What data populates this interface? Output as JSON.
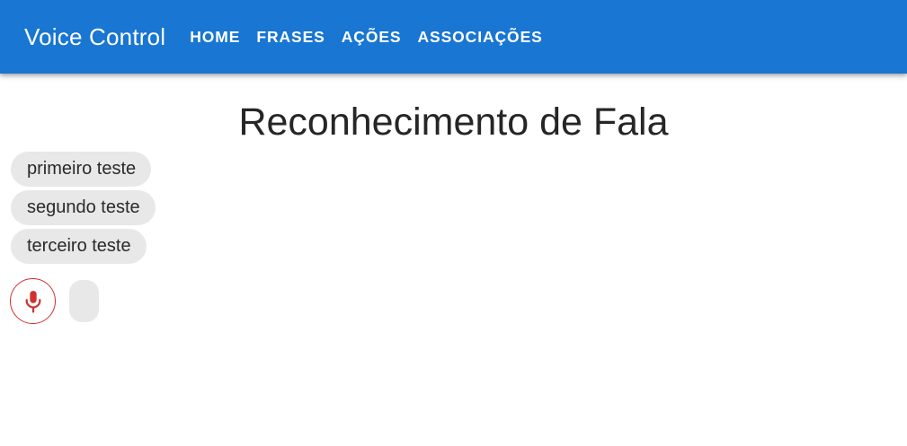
{
  "appbar": {
    "brand": "Voice Control",
    "color": "#1976d2",
    "nav": [
      {
        "label": "HOME"
      },
      {
        "label": "FRASES"
      },
      {
        "label": "AÇÕES"
      },
      {
        "label": "ASSOCIAÇÕES"
      }
    ]
  },
  "main": {
    "title": "Reconhecimento de Fala",
    "phrases": [
      {
        "text": "primeiro teste"
      },
      {
        "text": "segundo teste"
      },
      {
        "text": "terceiro teste"
      }
    ],
    "mic": {
      "icon": "microphone-icon",
      "color": "#d32f2f"
    },
    "transcript": ""
  }
}
